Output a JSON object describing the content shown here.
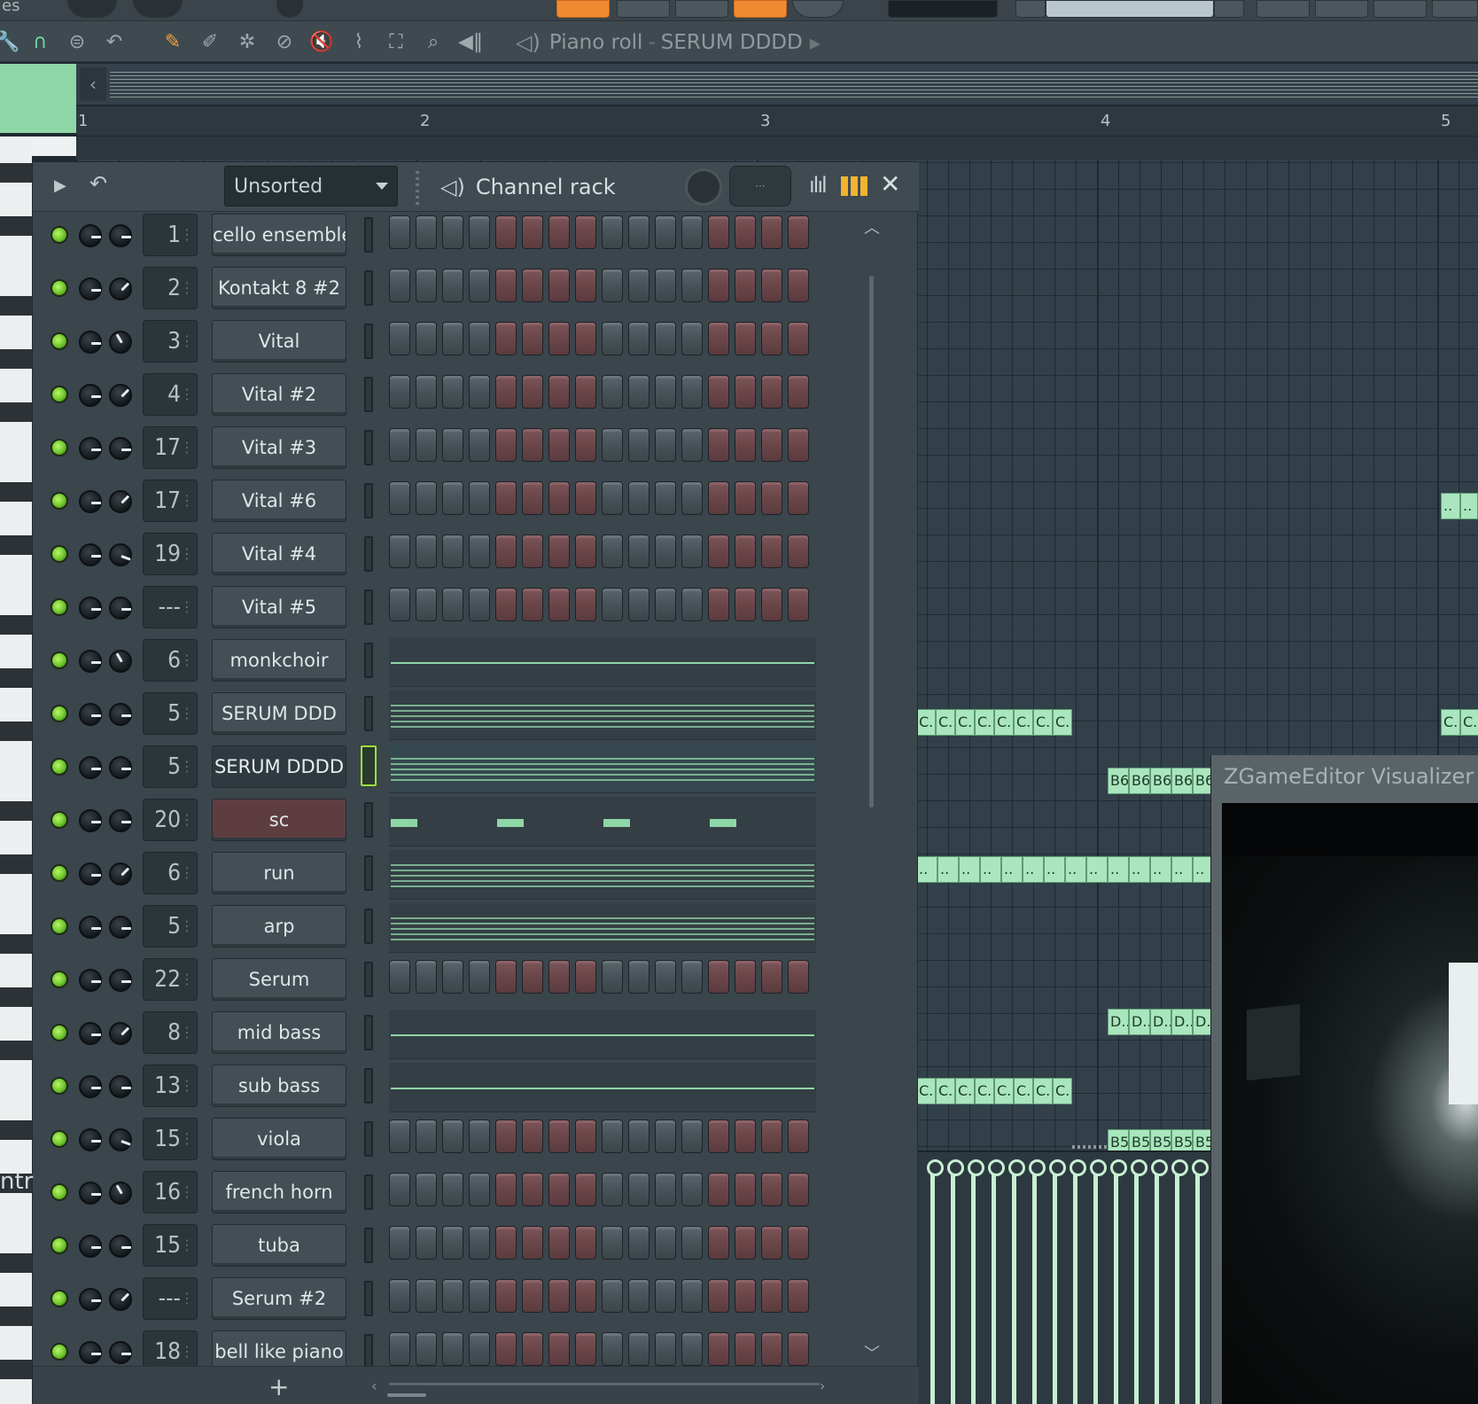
{
  "topbar": {
    "left_partial": "es"
  },
  "piano_roll": {
    "title_prefix": "Piano roll",
    "separator": "-",
    "target": "SERUM DDDD",
    "bars": [
      "1",
      "2",
      "3",
      "4",
      "5"
    ],
    "notes": [
      {
        "label": "C..",
        "row": "c1"
      },
      {
        "label": "C..",
        "row": "c1"
      },
      {
        "label": "C..",
        "row": "c1"
      },
      {
        "label": "C..",
        "row": "c1"
      },
      {
        "label": "C..",
        "row": "c1"
      },
      {
        "label": "C..",
        "row": "c1"
      },
      {
        "label": "C..",
        "row": "c1"
      },
      {
        "label": "C..",
        "row": "c1"
      },
      {
        "label": "B6",
        "row": "b6"
      },
      {
        "label": "B6",
        "row": "b6"
      },
      {
        "label": "B6",
        "row": "b6"
      },
      {
        "label": "B6",
        "row": "b6"
      },
      {
        "label": "B6",
        "row": "b6"
      },
      {
        "label": "D..",
        "row": "d"
      },
      {
        "label": "D..",
        "row": "d"
      },
      {
        "label": "D..",
        "row": "d"
      },
      {
        "label": "D..",
        "row": "d"
      },
      {
        "label": "D..",
        "row": "d"
      },
      {
        "label": "B5",
        "row": "b5"
      },
      {
        "label": "B5",
        "row": "b5"
      },
      {
        "label": "B5",
        "row": "b5"
      },
      {
        "label": "B5",
        "row": "b5"
      },
      {
        "label": "B5",
        "row": "b5"
      },
      {
        "label": "..",
        "row": "dot"
      }
    ]
  },
  "visualizer": {
    "title": "ZGameEditor Visualizer"
  },
  "channel_rack": {
    "filter": "Unsorted",
    "title": "Channel rack",
    "footer_add": "+",
    "channels": [
      {
        "track": "1",
        "name": "cello ensemble",
        "mode": "steps",
        "knob": "pan"
      },
      {
        "track": "2",
        "name": "Kontakt 8 #2",
        "mode": "steps",
        "knob": "k2"
      },
      {
        "track": "3",
        "name": "Vital",
        "mode": "steps",
        "knob": "k3"
      },
      {
        "track": "4",
        "name": "Vital #2",
        "mode": "steps",
        "knob": "k2"
      },
      {
        "track": "17",
        "name": "Vital #3",
        "mode": "steps",
        "knob": "pan"
      },
      {
        "track": "17",
        "name": "Vital #6",
        "mode": "steps",
        "knob": "k2"
      },
      {
        "track": "19",
        "name": "Vital #4",
        "mode": "steps",
        "knob": "k4"
      },
      {
        "track": "---",
        "name": "Vital #5",
        "mode": "steps",
        "knob": "pan"
      },
      {
        "track": "6",
        "name": "monkchoir",
        "mode": "pattern",
        "knob": "k3"
      },
      {
        "track": "5",
        "name": "SERUM DDD",
        "mode": "pattern",
        "knob": "pan"
      },
      {
        "track": "5",
        "name": "SERUM DDDD",
        "mode": "pattern",
        "knob": "pan",
        "selected": true
      },
      {
        "track": "20",
        "name": "sc",
        "mode": "blocks",
        "knob": "pan",
        "red": true
      },
      {
        "track": "6",
        "name": "run",
        "mode": "pattern",
        "knob": "k2"
      },
      {
        "track": "5",
        "name": "arp",
        "mode": "pattern",
        "knob": "pan"
      },
      {
        "track": "22",
        "name": "Serum",
        "mode": "steps",
        "knob": "pan"
      },
      {
        "track": "8",
        "name": "mid bass",
        "mode": "pattern",
        "knob": "k2"
      },
      {
        "track": "13",
        "name": "sub bass",
        "mode": "pattern",
        "knob": "pan"
      },
      {
        "track": "15",
        "name": "viola",
        "mode": "steps",
        "knob": "k4"
      },
      {
        "track": "16",
        "name": "french horn",
        "mode": "steps",
        "knob": "k3"
      },
      {
        "track": "15",
        "name": "tuba",
        "mode": "steps",
        "knob": "pan"
      },
      {
        "track": "---",
        "name": "Serum #2",
        "mode": "steps",
        "knob": "k2"
      },
      {
        "track": "18",
        "name": "bell like piano",
        "mode": "steps",
        "knob": "pan"
      }
    ]
  },
  "left_label": "ntr",
  "colors": {
    "note": "#a9e6bd",
    "accent_orange": "#f08a32",
    "led": "#6dc62b",
    "bars_icon": "#f2b42e"
  }
}
